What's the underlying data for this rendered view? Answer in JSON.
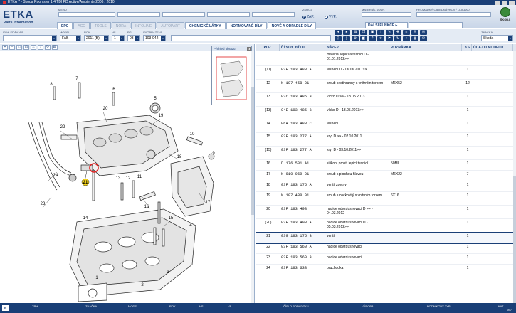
{
  "window": {
    "title": "ETKA 7 - Škoda Roomster 1.4 TDI PD Active/Ambiente 2006 / 2010"
  },
  "header": {
    "logo": "ETKA",
    "logo_sub": "Parts Information",
    "field_labels": [
      "MENU"
    ],
    "zap_label": "ZAP.",
    "vyp_label": "VYP.",
    "zdroj_label": "ZDROJ",
    "material_label": "MATERIÁL SOUP.",
    "hromadny_label": "HROMADNÝ OBJEDNÁVKOVÝ DOKLAD",
    "brand": "ŠKODA"
  },
  "tabs": [
    {
      "label": "EPC",
      "state": "active"
    },
    {
      "label": "ACC",
      "state": "inactive"
    },
    {
      "label": "TOOLS",
      "state": "inactive"
    },
    {
      "label": "NORA",
      "state": "inactive"
    },
    {
      "label": "INFOLINE",
      "state": "inactive"
    },
    {
      "label": "AUTOPART",
      "state": "inactive"
    },
    {
      "label": "CHEMICKÉ LÁTKY",
      "state": "bold"
    },
    {
      "label": "NORMOVANÉ DÍLY",
      "state": "bold"
    },
    {
      "label": "NOVÉ A ODPADLÉ DÍLY",
      "state": "bold"
    }
  ],
  "functions": {
    "label": "DALŠÍ FUNKCE ▸"
  },
  "filters": {
    "vyhledavani_label": "VYHLEDÁVÁNÍ",
    "model_label": "MODEL",
    "model_value": "FAB",
    "rok_label": "ROK",
    "rok_value": "2011 (B)",
    "hs_label": "HS",
    "hs_value": "1",
    "pg_label": "PG",
    "pg_value": "03",
    "vyobrazeni_label": "VYOBRAZENÍ",
    "vyobrazeni_value": "103-042",
    "znacka_label": "ZNAČKA",
    "znacka_value": "Skoda"
  },
  "overview": {
    "title": "Přehled obrazu",
    "close": "x"
  },
  "diagram": {
    "callouts": [
      "22",
      "23",
      "24",
      "21",
      "20",
      "19",
      "18",
      "17",
      "16",
      "15",
      "14",
      "13",
      "12",
      "11",
      "10",
      "9",
      "8",
      "7",
      "6",
      "5",
      "4",
      "3",
      "2",
      "1"
    ],
    "highlighted_callout": "21"
  },
  "table": {
    "columns": [
      "POZ.",
      "ČÍSLO DÍLU",
      "NÁZEV",
      "POZNÁMKA",
      "KS",
      "ÚDAJ O MODELU"
    ],
    "rows": [
      {
        "poz": "",
        "dil": "",
        "nazev": "materiál lepicí a tesnicí D - 01.01.2012>>",
        "pozn": "",
        "ks": "",
        "udaj": ""
      },
      {
        "poz": "(11)",
        "dil": "03F 103 483 A",
        "nazev": "tesnení D - 06.06.2011>>",
        "pozn": "",
        "ks": "1",
        "udaj": ""
      },
      {
        "poz": "12",
        "dil": "N    107 458 01",
        "nazev": "sroub sestihranny s vnitrním torxem",
        "pozn": "M6X52",
        "ks": "12",
        "udaj": ""
      },
      {
        "poz": "13",
        "dil": "03C 103 485 B",
        "nazev": "vícko D >> - 13.05.2013",
        "pozn": "",
        "ks": "1",
        "udaj": ""
      },
      {
        "poz": "(13)",
        "dil": "04E 103 485 B",
        "nazev": "vícko D - 13.05.2013>>",
        "pozn": "",
        "ks": "1",
        "udaj": ""
      },
      {
        "poz": "14",
        "dil": "06A 103 483 C",
        "nazev": "tesnení",
        "pozn": "",
        "ks": "1",
        "udaj": ""
      },
      {
        "poz": "15",
        "dil": "03F 103 277 A",
        "nazev": "kryt D >> - 02.10.2011",
        "pozn": "",
        "ks": "1",
        "udaj": ""
      },
      {
        "poz": "(15)",
        "dil": "03F 103 277 A",
        "nazev": "kryt D - 03.10.2011>>",
        "pozn": "",
        "ks": "1",
        "udaj": ""
      },
      {
        "poz": "16",
        "dil": "D    176 501 A1",
        "nazev": "silikon. prost. lepicí tesnicí",
        "pozn": "50ML",
        "ks": "1",
        "udaj": ""
      },
      {
        "poz": "17",
        "dil": "N    910 969 01",
        "nazev": "sroub s plochou hlavou",
        "pozn": "M6X22",
        "ks": "7",
        "udaj": ""
      },
      {
        "poz": "18",
        "dil": "03F 103 175 A",
        "nazev": "ventil zpetny",
        "pozn": "",
        "ks": "1",
        "udaj": ""
      },
      {
        "poz": "19",
        "dil": "N    107 480 01",
        "nazev": "sroub s cockovitý s vnitrním torxem",
        "pozn": "6X16",
        "ks": "1",
        "udaj": ""
      },
      {
        "poz": "20",
        "dil": "03F 103 493",
        "nazev": "hadice odvzdusnovací D >> - 04.03.2012",
        "pozn": "",
        "ks": "1",
        "udaj": ""
      },
      {
        "poz": "(20)",
        "dil": "03F 103 493 A",
        "nazev": "hadice odvzdusnovací D - 05.03.2012>>",
        "pozn": "",
        "ks": "1",
        "udaj": ""
      },
      {
        "poz": "21",
        "dil": "03G 103 175 B",
        "nazev": "ventil",
        "pozn": "",
        "ks": "1",
        "udaj": ""
      },
      {
        "poz": "22",
        "dil": "03F 103 560 A",
        "nazev": "hadice odvzdusnovací",
        "pozn": "",
        "ks": "1",
        "udaj": ""
      },
      {
        "poz": "23",
        "dil": "03F 103 560 B",
        "nazev": "hadice odvzdusnovací",
        "pozn": "",
        "ks": "1",
        "udaj": ""
      },
      {
        "poz": "24",
        "dil": "03F 103 638",
        "nazev": "pruchodka",
        "pozn": "",
        "ks": "1",
        "udaj": ""
      }
    ],
    "selected_index": 14
  },
  "status": {
    "items": [
      "TRH",
      "ZNAČKA",
      "MODEL",
      "ROK",
      "HS",
      "VS",
      "ČÍSLO PODVOZKU",
      "VÝROBA",
      "PODNIKOVÝ TYP",
      "KAT"
    ],
    "kat_value": "697"
  },
  "colors": {
    "accent": "#1a3f77",
    "highlight": "#e02020",
    "callout_yellow": "#f2d21b"
  }
}
